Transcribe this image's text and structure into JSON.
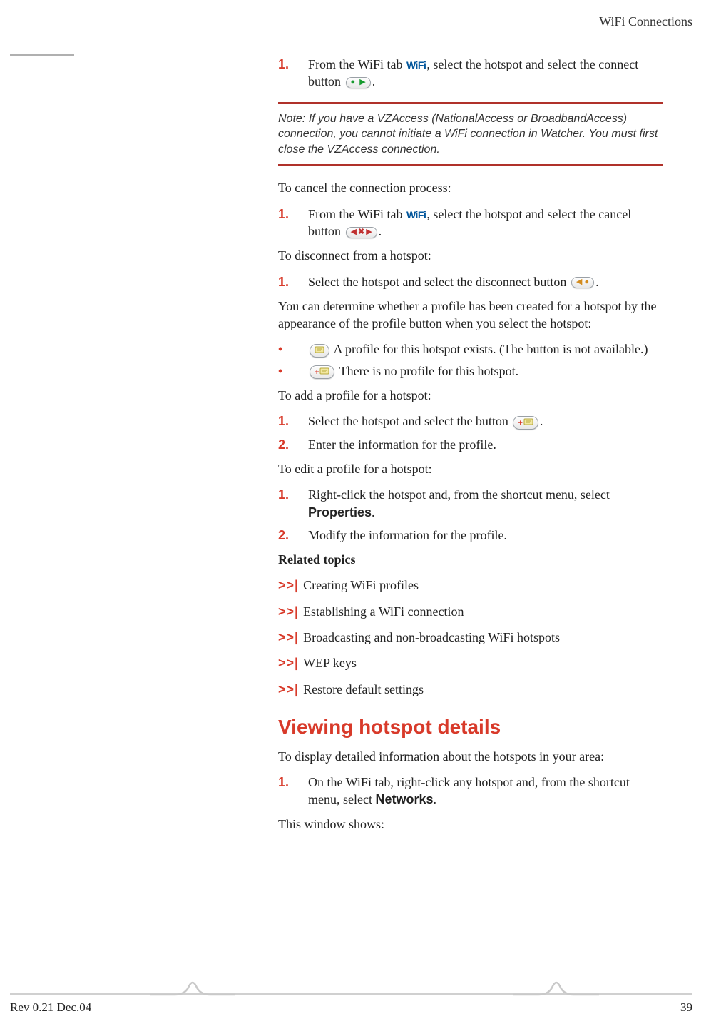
{
  "header": {
    "section_title": "WiFi Connections"
  },
  "wifi_tab_label": "WiFi",
  "step_connect": {
    "pre": "From the WiFi tab ",
    "mid": ", select the hotspot and select the connect button ",
    "post": "."
  },
  "note": {
    "label": "Note:",
    "text": "  If you have a VZAccess (NationalAccess or Broadban­dAccess) connection, you cannot initiate a WiFi connection in Watcher. You must first close the VZAccess connection."
  },
  "cancel_intro": "To cancel the connection process:",
  "step_cancel": {
    "pre": "From the WiFi tab ",
    "mid": ", select the hotspot and select the cancel button ",
    "post": "."
  },
  "disconnect_intro": "To disconnect from a hotspot:",
  "step_disconnect": {
    "pre": "Select the hotspot and select the disconnect button ",
    "post": "."
  },
  "profile_intro": "You can determine whether a profile has been created for a hotspot by the appearance of the profile button when you select the hotspot:",
  "profile_exists": " A profile for this hotspot exists. (The button is not available.)",
  "profile_none": " There is no profile for this hotspot.",
  "add_intro": "To add a profile for a hotspot:",
  "step_add": {
    "pre": "Select the hotspot and select the button ",
    "post": "."
  },
  "step_add2": "Enter the information for the profile.",
  "edit_intro": "To edit a profile for a hotspot:",
  "step_edit1_pre": "Right-click the hotspot and, from the shortcut menu, select ",
  "properties_label": "Properties",
  "step_edit1_post": ".",
  "step_edit2": "Modify the information for the profile.",
  "related_heading": "Related topics",
  "related_links": [
    "Creating WiFi profiles",
    "Establishing a WiFi connection",
    "Broadcasting and non-broadcasting WiFi hotspots",
    "WEP keys",
    "Restore default settings"
  ],
  "section2_title": "Viewing hotspot details",
  "section2_intro": "To display detailed information about the hotspots in your area:",
  "section2_step_pre": "On the WiFi tab, right-click any hotspot and, from the shortcut menu, select ",
  "networks_label": "Networks",
  "section2_step_post": ".",
  "section2_tail": "This window shows:",
  "footer": {
    "left": "Rev 0.21  Dec.04",
    "right": "39"
  }
}
